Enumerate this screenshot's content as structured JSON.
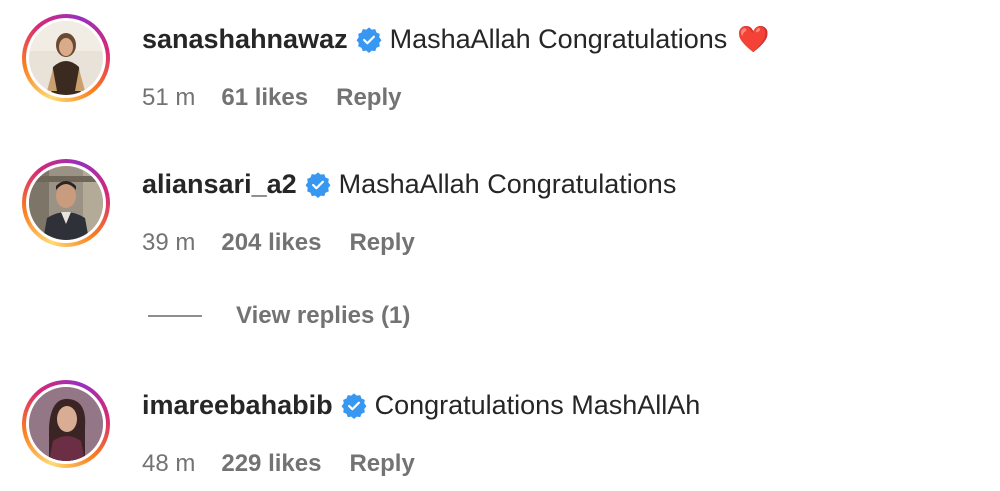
{
  "comments": [
    {
      "username": "sanashahnawaz",
      "text": "MashaAllah Congratulations",
      "emoji": "❤️",
      "time": "51 m",
      "likes": "61 likes",
      "reply": "Reply",
      "verified": true,
      "avatar_icon": "woman-portrait-avatar"
    },
    {
      "username": "aliansari_a2",
      "text": "MashaAllah Congratulations",
      "time": "39 m",
      "likes": "204 likes",
      "reply": "Reply",
      "verified": true,
      "avatar_icon": "man-portrait-avatar"
    },
    {
      "username": "imareebahabib",
      "text": "Congratulations MashAllAh",
      "time": "48 m",
      "likes": "229 likes",
      "reply": "Reply",
      "verified": true,
      "avatar_icon": "woman-portrait-avatar"
    }
  ],
  "view_replies": "View replies (1)",
  "colors": {
    "verified_badge": "#3897f0",
    "meta_text": "#737373",
    "primary_text": "#262626",
    "heart": "#e0245e"
  }
}
